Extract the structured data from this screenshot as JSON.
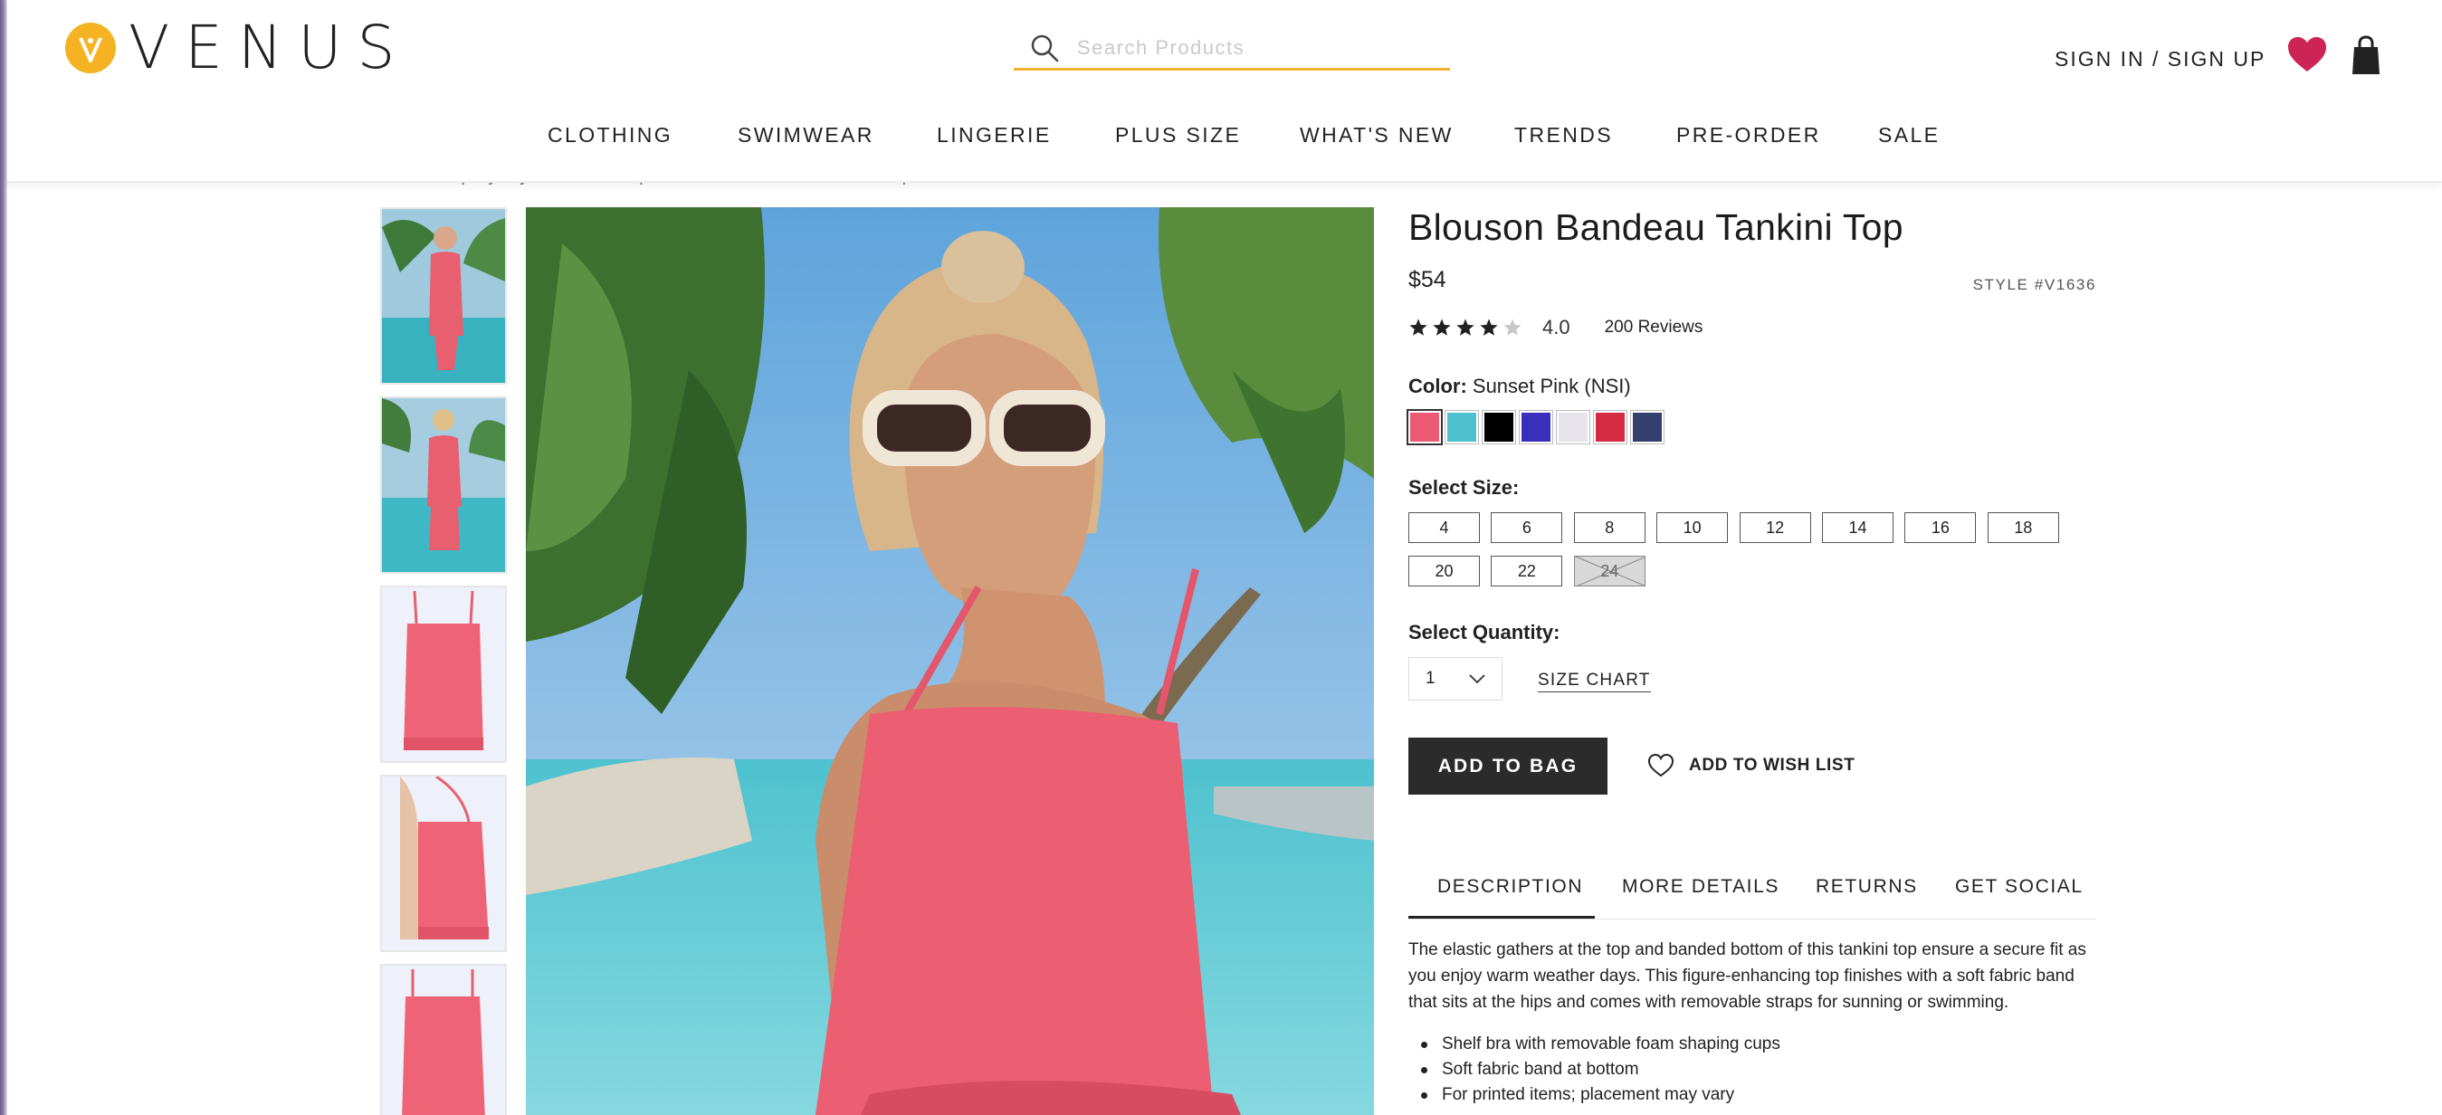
{
  "brand": {
    "name": "VENUS",
    "accent": "#f5b324"
  },
  "search": {
    "placeholder": "Search Products",
    "value": ""
  },
  "account": {
    "signin_label": "SIGN IN / SIGN UP"
  },
  "icons": {
    "wishlist": "heart-icon",
    "bag": "shopping-bag-icon",
    "search": "search-icon"
  },
  "nav": [
    "CLOTHING",
    "SWIMWEAR",
    "LINGERIE",
    "PLUS SIZE",
    "WHAT'S NEW",
    "TRENDS",
    "PRE-ORDER",
    "SALE"
  ],
  "breadcrumb": "Swim Shop By Style  /  Tankini Tops  /  Blouson Bandeau Tankini Top",
  "product": {
    "title": "Blouson Bandeau Tankini Top",
    "price": "$54",
    "style": "STYLE #V1636",
    "rating": {
      "value": "4.0",
      "stars": 4,
      "max": 5
    },
    "reviews": "200 Reviews",
    "color_label": "Color:",
    "color_value": "Sunset Pink (NSI)",
    "colors": [
      "#ea5a74",
      "#4dc1cf",
      "#000000",
      "#3a2fbd",
      "#e6e4ea",
      "#d42b43",
      "#343f6e"
    ],
    "size_label": "Select Size:",
    "sizes": [
      {
        "label": "4",
        "available": true
      },
      {
        "label": "6",
        "available": true
      },
      {
        "label": "8",
        "available": true
      },
      {
        "label": "10",
        "available": true
      },
      {
        "label": "12",
        "available": true
      },
      {
        "label": "14",
        "available": true
      },
      {
        "label": "16",
        "available": true
      },
      {
        "label": "18",
        "available": true
      },
      {
        "label": "20",
        "available": true
      },
      {
        "label": "22",
        "available": true
      },
      {
        "label": "24",
        "available": false
      }
    ],
    "quantity_label": "Select Quantity:",
    "quantity": "1",
    "size_chart": "SIZE CHART",
    "add_to_bag": "ADD TO BAG",
    "wish_list": "ADD TO WISH LIST"
  },
  "tabs": [
    "DESCRIPTION",
    "MORE DETAILS",
    "RETURNS",
    "GET SOCIAL"
  ],
  "description": "The elastic gathers at the top and banded bottom of this tankini top ensure a secure fit as you enjoy warm weather days. This figure-enhancing top finishes with a soft fabric band that sits at the hips and comes with removable straps for sunning or swimming.",
  "features": [
    "Shelf bra with removable foam shaping cups",
    "Soft fabric band at bottom",
    "For printed items; placement may vary"
  ]
}
